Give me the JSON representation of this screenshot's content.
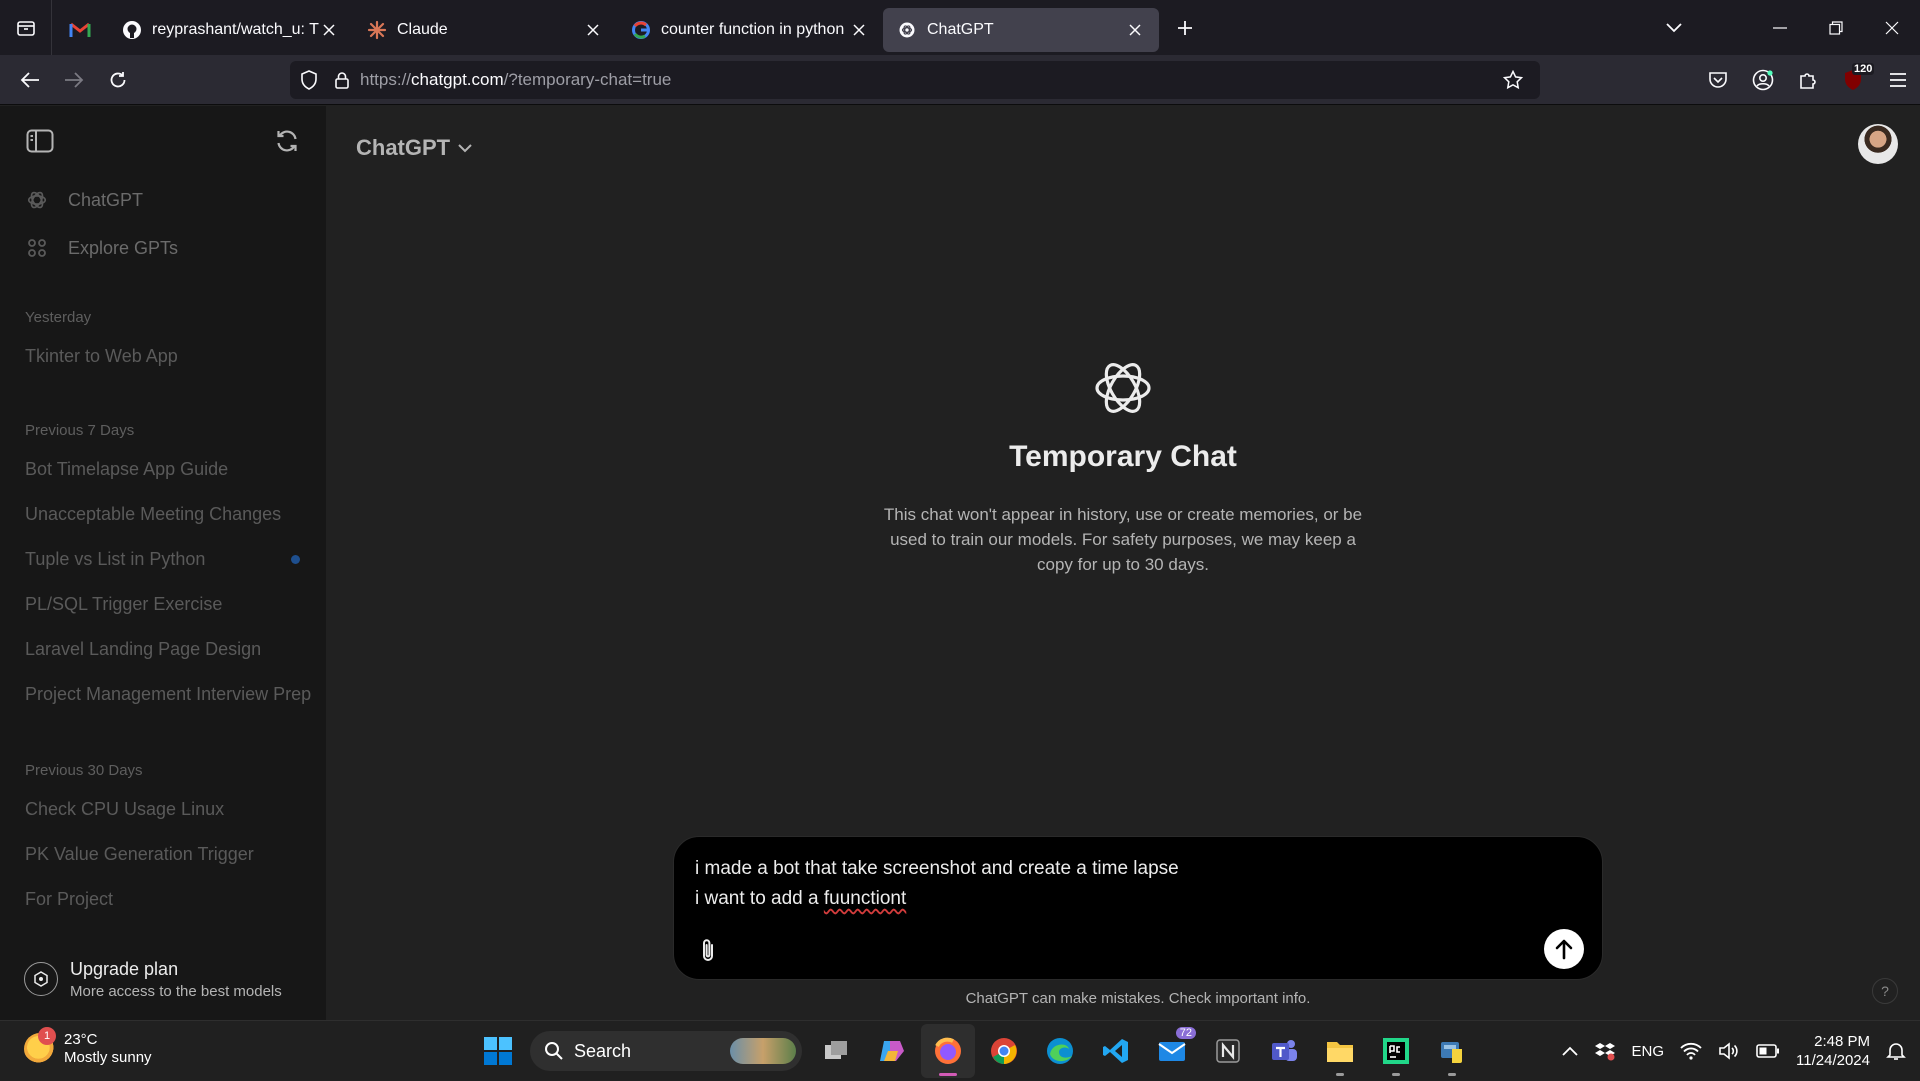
{
  "browser": {
    "tabs": [
      {
        "title": "",
        "icon": "gmail-icon",
        "pinned": true
      },
      {
        "title": "reyprashant/watch_u: This is the",
        "icon": "github-icon"
      },
      {
        "title": "Claude",
        "icon": "claude-icon"
      },
      {
        "title": "counter function in python - Go",
        "icon": "google-icon"
      },
      {
        "title": "ChatGPT",
        "icon": "chatgpt-icon",
        "active": true
      }
    ],
    "url_prefix": "https://",
    "url_host": "chatgpt.com",
    "url_path": "/?temporary-chat=true",
    "extension_badge": "120"
  },
  "sidebar": {
    "nav": [
      {
        "label": "ChatGPT",
        "icon": "chatgpt-icon"
      },
      {
        "label": "Explore GPTs",
        "icon": "grid-icon"
      }
    ],
    "groups": [
      {
        "label": "Yesterday",
        "items": [
          "Tkinter to Web App"
        ]
      },
      {
        "label": "Previous 7 Days",
        "items": [
          "Bot Timelapse App Guide",
          "Unacceptable Meeting Changes",
          "Tuple vs List in Python",
          "PL/SQL Trigger Exercise",
          "Laravel Landing Page Design",
          "Project Management Interview Prep"
        ]
      },
      {
        "label": "Previous 30 Days",
        "items": [
          "Check CPU Usage Linux",
          "PK Value Generation Trigger",
          "For Project"
        ]
      }
    ],
    "upgrade_title": "Upgrade plan",
    "upgrade_subtitle": "More access to the best models"
  },
  "main": {
    "model": "ChatGPT",
    "hero_title": "Temporary Chat",
    "hero_text": "This chat won't appear in history, use or create memories, or be used to train our models. For safety purposes, we may keep a copy for up to 30 days.",
    "composer_line1": "i made a bot that take screenshot and create a time lapse",
    "composer_line2_prefix": "i want to add a ",
    "composer_line2_misspelled": "fuunctiont",
    "disclaimer": "ChatGPT can make mistakes. Check important info.",
    "help": "?"
  },
  "taskbar": {
    "weather_temp": "23°C",
    "weather_desc": "Mostly sunny",
    "weather_badge": "1",
    "search_label": "Search",
    "mail_badge": "72",
    "lang": "ENG",
    "time": "2:48 PM",
    "date": "11/24/2024"
  },
  "colors": {
    "sidebar_bg": "#171717",
    "main_bg": "#212121",
    "composer_bg": "#000000",
    "send_bg": "#ffffff"
  }
}
